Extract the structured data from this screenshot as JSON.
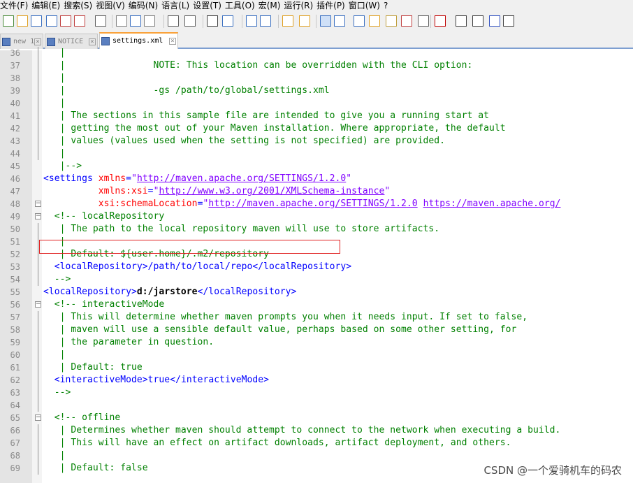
{
  "menu": [
    "文件(F)",
    "编辑(E)",
    "搜索(S)",
    "视图(V)",
    "编码(N)",
    "语言(L)",
    "设置(T)",
    "工具(O)",
    "宏(M)",
    "运行(R)",
    "插件(P)",
    "窗口(W)",
    "?"
  ],
  "tabs": [
    {
      "label": "new 1"
    },
    {
      "label": "NOTICE"
    },
    {
      "label": "settings.xml"
    }
  ],
  "toolbar_icons": [
    "new-file-icon",
    "open-icon",
    "save-icon",
    "save-all-icon",
    "close-icon",
    "close-all-icon",
    "print-icon",
    "cut-icon",
    "copy-icon",
    "paste-icon",
    "undo-icon",
    "redo-icon",
    "find-icon",
    "replace-icon",
    "zoom-in-icon",
    "zoom-out-icon",
    "sync-v-icon",
    "sync-h-icon",
    "wrap-icon",
    "show-all-chars-icon",
    "indent-guide-icon",
    "doc-map-icon",
    "function-list-icon",
    "folder-workspace-icon",
    "monitor-icon",
    "record-macro-icon",
    "stop-macro-icon",
    "play-macro-icon",
    "run-macro-multiple-icon",
    "save-macro-icon"
  ],
  "lines": [
    {
      "n": "36",
      "text": "   |"
    },
    {
      "n": "37",
      "text": "   |                NOTE: This location can be overridden with the CLI option:"
    },
    {
      "n": "38",
      "text": "   |"
    },
    {
      "n": "39",
      "text": "   |                -gs /path/to/global/settings.xml"
    },
    {
      "n": "40",
      "text": "   |"
    },
    {
      "n": "41",
      "text": "   | The sections in this sample file are intended to give you a running start at"
    },
    {
      "n": "42",
      "text": "   | getting the most out of your Maven installation. Where appropriate, the default"
    },
    {
      "n": "43",
      "text": "   | values (values used when the setting is not specified) are provided."
    },
    {
      "n": "44",
      "text": "   |"
    },
    {
      "n": "45",
      "text": "   |-->"
    },
    {
      "n": "46",
      "text": ""
    },
    {
      "n": "47",
      "text": ""
    },
    {
      "n": "48",
      "text": ""
    },
    {
      "n": "49",
      "text": "  <!-- localRepository"
    },
    {
      "n": "50",
      "text": "   | The path to the local repository maven will use to store artifacts."
    },
    {
      "n": "51",
      "text": "   |"
    },
    {
      "n": "52",
      "text": "   | Default: ${user.home}/.m2/repository"
    },
    {
      "n": "53",
      "text": "  <localRepository>/path/to/local/repo</localRepository>"
    },
    {
      "n": "54",
      "text": "  -->"
    },
    {
      "n": "55",
      "text": ""
    },
    {
      "n": "56",
      "text": "  <!-- interactiveMode"
    },
    {
      "n": "57",
      "text": "   | This will determine whether maven prompts you when it needs input. If set to false,"
    },
    {
      "n": "58",
      "text": "   | maven will use a sensible default value, perhaps based on some other setting, for"
    },
    {
      "n": "59",
      "text": "   | the parameter in question."
    },
    {
      "n": "60",
      "text": "   |"
    },
    {
      "n": "61",
      "text": "   | Default: true"
    },
    {
      "n": "62",
      "text": "  <interactiveMode>true</interactiveMode>"
    },
    {
      "n": "63",
      "text": "  -->"
    },
    {
      "n": "64",
      "text": ""
    },
    {
      "n": "65",
      "text": "  <!-- offline"
    },
    {
      "n": "66",
      "text": "   | Determines whether maven should attempt to connect to the network when executing a build."
    },
    {
      "n": "67",
      "text": "   | This will have an effect on artifact downloads, artifact deployment, and others."
    },
    {
      "n": "68",
      "text": "   |"
    },
    {
      "n": "69",
      "text": "   | Default: false"
    }
  ],
  "settings_tag": {
    "open": "<settings",
    "xmlns_attr": "xmlns",
    "eq": "=",
    "q": "\"",
    "xmlns_val": "http://maven.apache.org/SETTINGS/1.2.0",
    "xsi_attr": "xmlns:xsi",
    "xsi_val": "http://www.w3.org/2001/XMLSchema-instance",
    "schema_attr": "xsi:schemaLocation",
    "schema_val1": "http://maven.apache.org/SETTINGS/1.2.0",
    "schema_val2": "https://maven.apache.org/"
  },
  "local_repo": {
    "open": "<localRepository>",
    "value": "d:/jarstore",
    "close": "</localRepository>"
  },
  "watermark": "CSDN @一个爱骑机车的码农"
}
